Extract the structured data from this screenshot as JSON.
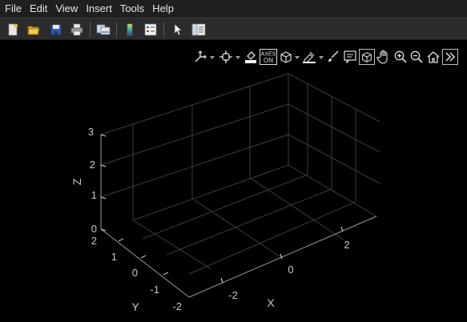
{
  "window": {
    "menu": [
      "File",
      "Edit",
      "View",
      "Insert",
      "Tools",
      "Help"
    ]
  },
  "toolbar": {
    "buttons": [
      "new-figure-icon",
      "open-file-icon",
      "save-icon",
      "print-icon",
      "link-plot-icon",
      "insert-colorbar-icon",
      "insert-legend-icon",
      "edit-plot-pointer-icon",
      "property-inspector-icon"
    ]
  },
  "axes_toolbar": {
    "buttons": [
      "data-tips-icon",
      "data-cursor-icon",
      "brush-icon",
      "datatips-on-icon",
      "rotate-3d-icon",
      "restore-view-icon",
      "pan-icon",
      "zoom-in-icon",
      "zoom-out-icon",
      "home-icon",
      "more-icon"
    ],
    "datatips_label_1": "AXES",
    "datatips_label_2": "ON"
  },
  "plot": {
    "xlabel": "X",
    "ylabel": "Y",
    "zlabel": "Z",
    "x_ticks": [
      "-2",
      "0",
      "2"
    ],
    "y_ticks": [
      "2",
      "1",
      "0",
      "-1",
      "-2"
    ],
    "z_ticks": [
      "0",
      "1",
      "2",
      "3"
    ],
    "colors": {
      "background": "#000000",
      "grid": "#3c3c3c",
      "axis": "#9a9a9a",
      "text": "#c8c8c8"
    }
  }
}
